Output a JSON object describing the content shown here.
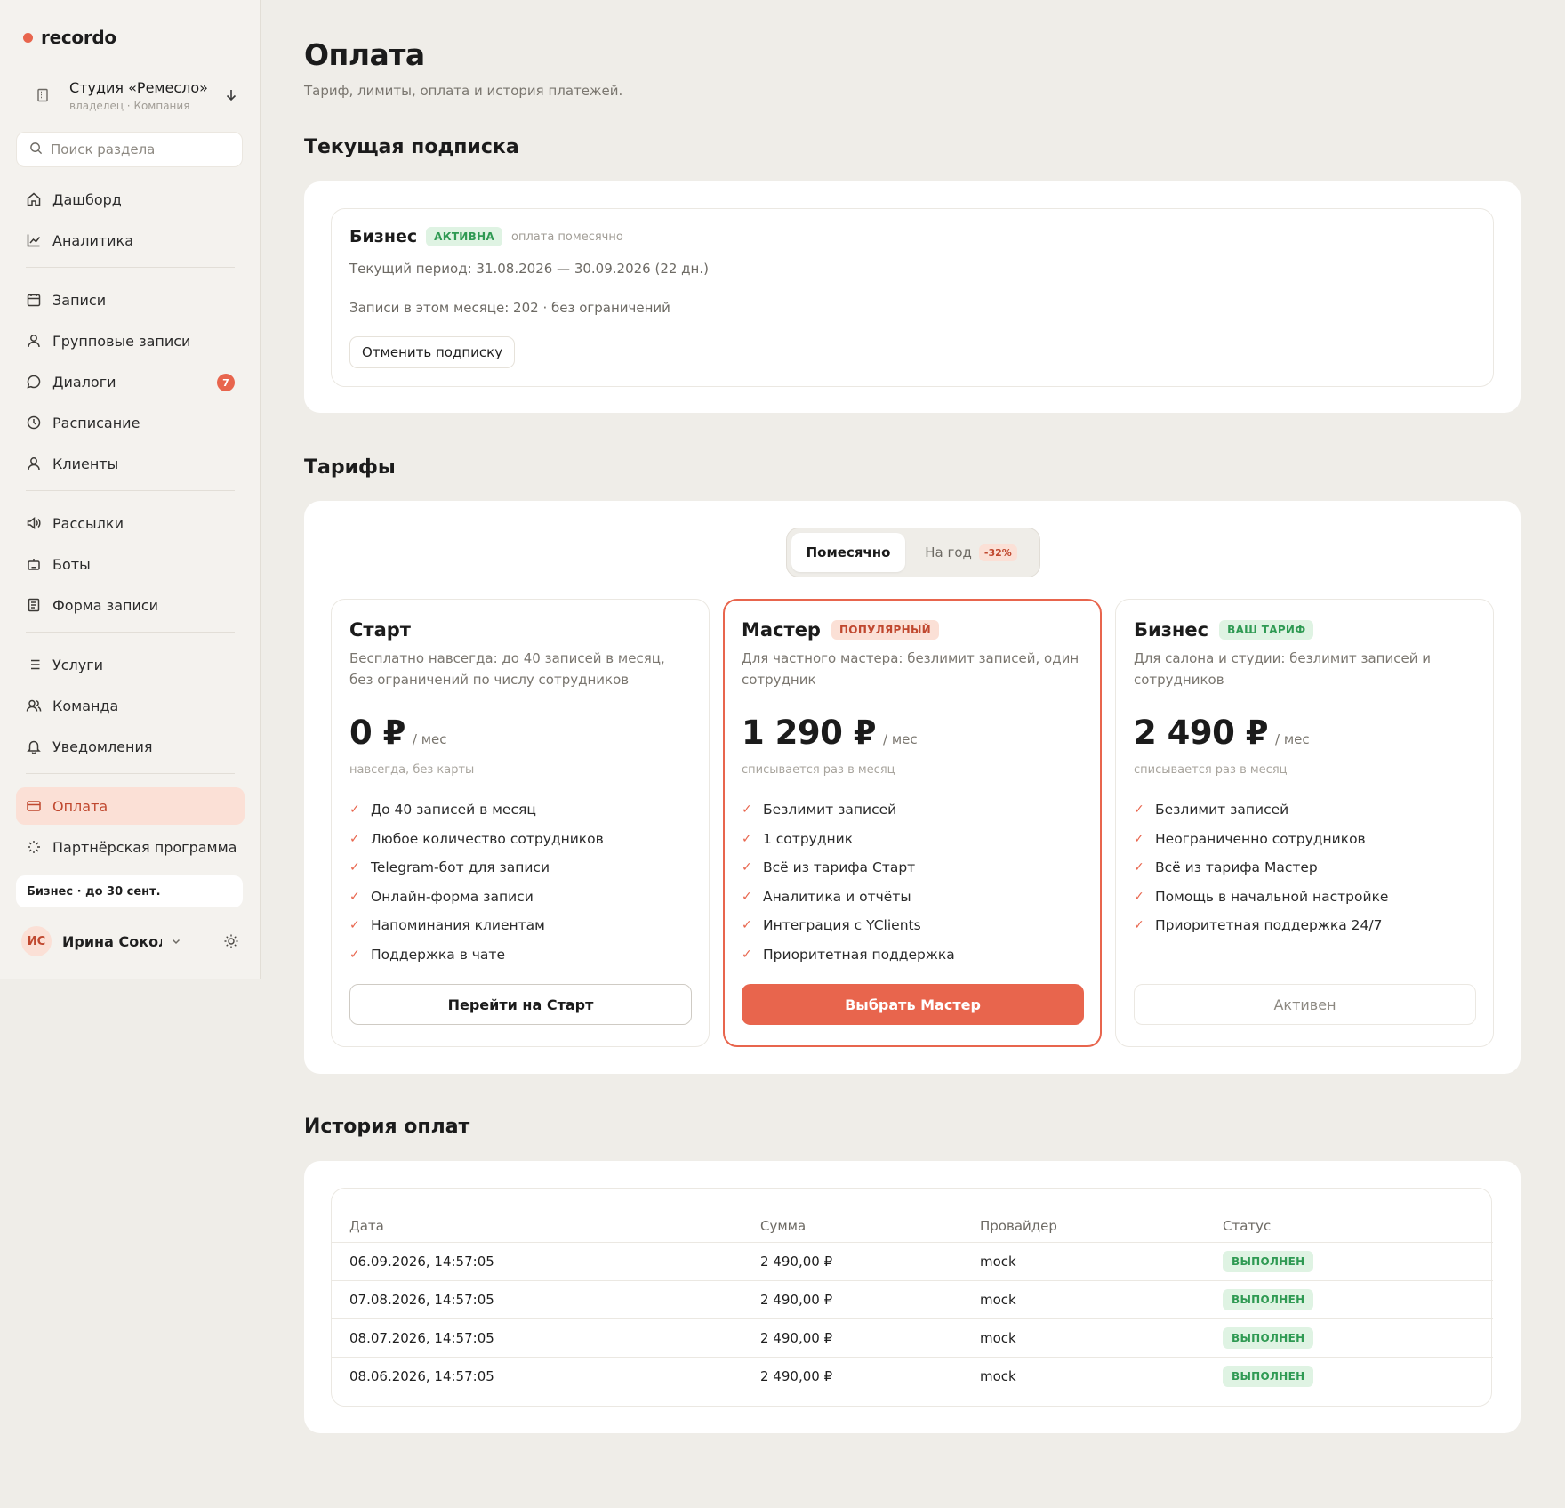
{
  "app": {
    "logo": "recordo",
    "brand_color": "#e8654d"
  },
  "workspace": {
    "name": "Студия «Ремесло»",
    "role": "владелец · Компания"
  },
  "search": {
    "placeholder": "Поиск раздела"
  },
  "nav": {
    "group1": [
      {
        "label": "Дашборд",
        "icon": "home-icon"
      },
      {
        "label": "Аналитика",
        "icon": "chart-icon"
      }
    ],
    "group2": [
      {
        "label": "Записи",
        "icon": "calendar-icon"
      },
      {
        "label": "Групповые записи",
        "icon": "user-icon"
      },
      {
        "label": "Диалоги",
        "icon": "chat-icon",
        "badge": "7"
      },
      {
        "label": "Расписание",
        "icon": "clock-icon"
      },
      {
        "label": "Клиенты",
        "icon": "user-icon"
      }
    ],
    "group3": [
      {
        "label": "Рассылки",
        "icon": "megaphone-icon"
      },
      {
        "label": "Боты",
        "icon": "bot-icon"
      },
      {
        "label": "Форма записи",
        "icon": "form-icon"
      }
    ],
    "group4": [
      {
        "label": "Услуги",
        "icon": "list-icon"
      },
      {
        "label": "Команда",
        "icon": "team-icon"
      },
      {
        "label": "Уведомления",
        "icon": "bell-icon"
      }
    ],
    "group5": [
      {
        "label": "Оплата",
        "icon": "card-icon",
        "active": true
      },
      {
        "label": "Партнёрская программа",
        "icon": "sparkle-icon"
      }
    ]
  },
  "plan_chip": "Бизнес · до 30 сент.",
  "user": {
    "initials": "ИС",
    "name": "Ирина Сокол..."
  },
  "page": {
    "title": "Оплата",
    "subtitle": "Тариф, лимиты, оплата и история платежей."
  },
  "current": {
    "section_title": "Текущая подписка",
    "plan_name": "Бизнес",
    "status": "АКТИВНА",
    "billing": "оплата помесячно",
    "period": "Текущий период: 31.08.2026 — 30.09.2026 (22 дн.)",
    "usage": "Записи в этом месяце: 202 · без ограничений",
    "cancel_label": "Отменить подписку"
  },
  "tariffs": {
    "section_title": "Тарифы",
    "toggle": {
      "monthly": "Помесячно",
      "yearly": "На год",
      "discount": "-32%"
    },
    "plans": [
      {
        "name": "Старт",
        "badge": "",
        "desc": "Бесплатно навсегда: до 40 записей в месяц, без ограничений по числу сотрудников",
        "price": "0 ₽",
        "per": "/ мес",
        "note": "навсегда, без карты",
        "features": [
          "До 40 записей в месяц",
          "Любое количество сотрудников",
          "Telegram-бот для записи",
          "Онлайн-форма записи",
          "Напоминания клиентам",
          "Поддержка в чате"
        ],
        "button": "Перейти на Старт"
      },
      {
        "name": "Мастер",
        "badge": "ПОПУЛЯРНЫЙ",
        "desc": "Для частного мастера: безлимит записей, один сотрудник",
        "price": "1 290 ₽",
        "per": "/ мес",
        "note": "списывается раз в месяц",
        "features": [
          "Безлимит записей",
          "1 сотрудник",
          "Всё из тарифа Старт",
          "Аналитика и отчёты",
          "Интеграция с YClients",
          "Приоритетная поддержка"
        ],
        "button": "Выбрать Мастер"
      },
      {
        "name": "Бизнес",
        "badge": "ВАШ ТАРИФ",
        "desc": "Для салона и студии: безлимит записей и сотрудников",
        "price": "2 490 ₽",
        "per": "/ мес",
        "note": "списывается раз в месяц",
        "features": [
          "Безлимит записей",
          "Неограниченно сотрудников",
          "Всё из тарифа Мастер",
          "Помощь в начальной настройке",
          "Приоритетная поддержка 24/7"
        ],
        "button": "Активен"
      }
    ]
  },
  "history": {
    "section_title": "История оплат",
    "columns": [
      "Дата",
      "Сумма",
      "Провайдер",
      "Статус"
    ],
    "rows": [
      {
        "date": "06.09.2026, 14:57:05",
        "amount": "2 490,00 ₽",
        "provider": "mock",
        "status": "ВЫПОЛНЕН"
      },
      {
        "date": "07.08.2026, 14:57:05",
        "amount": "2 490,00 ₽",
        "provider": "mock",
        "status": "ВЫПОЛНЕН"
      },
      {
        "date": "08.07.2026, 14:57:05",
        "amount": "2 490,00 ₽",
        "provider": "mock",
        "status": "ВЫПОЛНЕН"
      },
      {
        "date": "08.06.2026, 14:57:05",
        "amount": "2 490,00 ₽",
        "provider": "mock",
        "status": "ВЫПОЛНЕН"
      }
    ]
  }
}
